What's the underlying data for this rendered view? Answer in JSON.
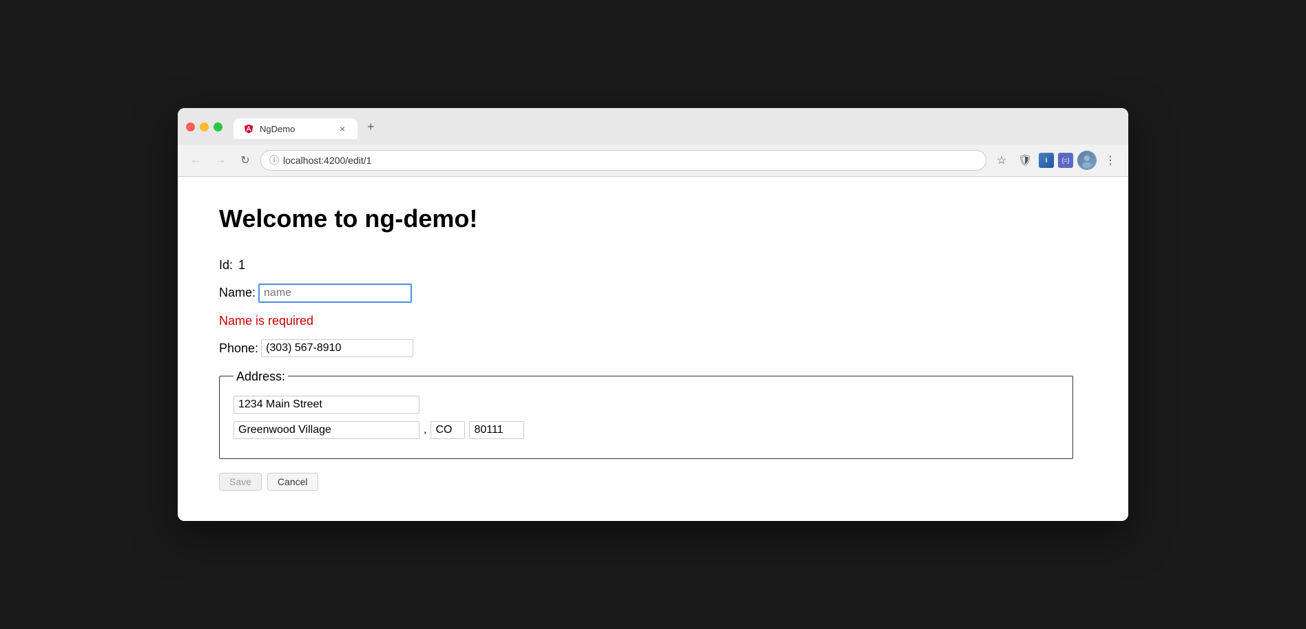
{
  "browser": {
    "tab_title": "NgDemo",
    "tab_close": "×",
    "tab_new": "+",
    "url_scheme": "localhost",
    "url_path": ":4200/edit/1",
    "url_full": "localhost:4200/edit/1"
  },
  "nav": {
    "back": "←",
    "forward": "→",
    "reload": "↻",
    "info": "ⓘ",
    "bookmark": "☆",
    "menu": "⋮"
  },
  "page": {
    "heading": "Welcome to ng-demo!",
    "id_label": "Id:",
    "id_value": "1",
    "name_label": "Name:",
    "name_placeholder": "name",
    "name_error": "Name is required",
    "phone_label": "Phone:",
    "phone_value": "(303) 567-8910",
    "address_legend": "Address:",
    "address_street": "1234 Main Street",
    "address_city": "Greenwood Village",
    "address_comma": ",",
    "address_state": "CO",
    "address_zip": "80111",
    "save_label": "Save",
    "cancel_label": "Cancel"
  }
}
